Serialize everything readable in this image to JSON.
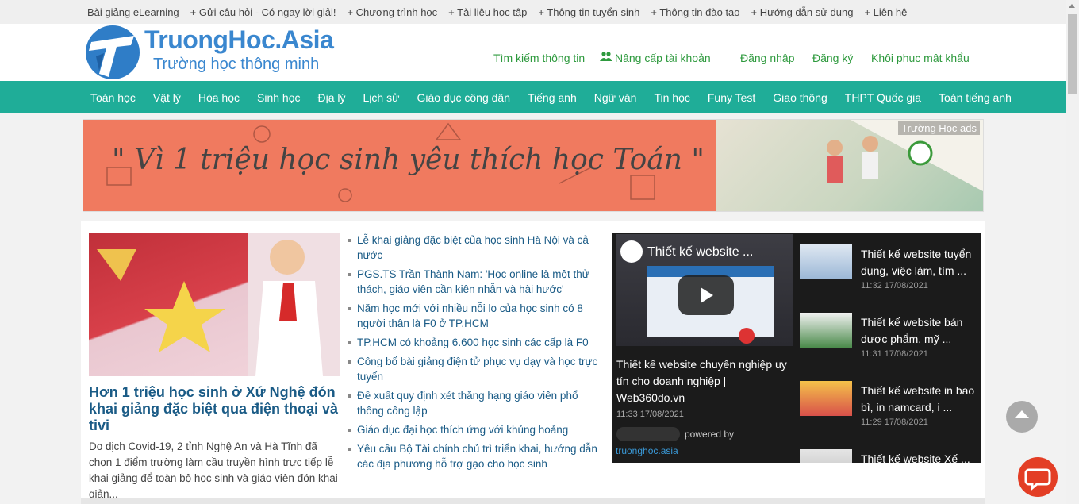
{
  "topbar": {
    "links": [
      "Bài giảng eLearning",
      "+ Gửi câu hỏi - Có ngay lời giải!",
      "+ Chương trình học",
      "+ Tài liệu học tập",
      "+ Thông tin tuyển sinh",
      "+ Thông tin đào tạo",
      "+ Hướng dẫn sử dụng",
      "+ Liên hệ"
    ]
  },
  "header": {
    "logo_title": "TruongHoc.Asia",
    "logo_sub": "Trường học thông minh",
    "search": "Tìm kiếm thông tin",
    "upgrade": "Nâng cấp tài khoản",
    "login": "Đăng nhập",
    "register": "Đăng ký",
    "recover": "Khôi phục mật khẩu"
  },
  "nav": [
    "Toán học",
    "Vật lý",
    "Hóa học",
    "Sinh học",
    "Địa lý",
    "Lịch sử",
    "Giáo dục công dân",
    "Tiếng anh",
    "Ngữ văn",
    "Tin học",
    "Funy Test",
    "Giao thông",
    "THPT Quốc gia",
    "Toán tiếng anh"
  ],
  "banner": {
    "text": "\" Vì 1 triệu học sinh yêu thích học Toán \"",
    "ads_label": "Trường Học ads"
  },
  "lead": {
    "title": "Hơn 1 triệu học sinh ở Xứ Nghệ đón khai giảng đặc biệt qua điện thoại và tivi",
    "desc": "Do dịch Covid-19, 2 tỉnh Nghệ An và Hà Tĩnh đã chọn 1 điểm trường làm cầu truyền hình trực tiếp lễ khai giảng để toàn bộ học sinh và giáo viên đón khai giản..."
  },
  "news": [
    "Lễ khai giảng đặc biệt của học sinh Hà Nội và cả nước",
    "PGS.TS Trần Thành Nam: 'Học online là một thử thách, giáo viên cần kiên nhẫn và hài hước'",
    "Năm học mới với nhiều nỗi lo của học sinh có 8 người thân là F0 ở TP.HCM",
    "TP.HCM có khoảng 6.600 học sinh các cấp là F0",
    "Công bố bài giảng điện tử phục vụ dạy và học trực tuyến",
    "Đề xuất quy định xét thăng hạng giáo viên phổ thông công lập",
    "Giáo dục đại học thích ứng với khủng hoảng",
    "Yêu cầu Bộ Tài chính chủ trì triển khai, hướng dẫn các địa phương hỗ trợ gạo cho học sinh"
  ],
  "video": {
    "overlay_title": "Thiết kế website ...",
    "title": "Thiết kế website chuyên nghiệp uy tín cho doanh nghiệp | Web360do.vn",
    "time": "11:33 17/08/2021",
    "powered": "powered by",
    "site": "truonghoc.asia",
    "side": [
      {
        "title": "Thiết kế website tuyển dụng, việc làm, tìm ...",
        "time": "11:32 17/08/2021"
      },
      {
        "title": "Thiết kế website bán dược phẩm, mỹ ...",
        "time": "11:31 17/08/2021"
      },
      {
        "title": "Thiết kế website in bao bì, in namcard, i ...",
        "time": "11:29 17/08/2021"
      },
      {
        "title": "Thiết kế website Xế ...",
        "time": ""
      }
    ]
  },
  "colors": {
    "nav_bg": "#1fad98",
    "link_green": "#2e9a3e",
    "title_blue": "#1a5b86",
    "brand_blue": "#3a87cf"
  }
}
